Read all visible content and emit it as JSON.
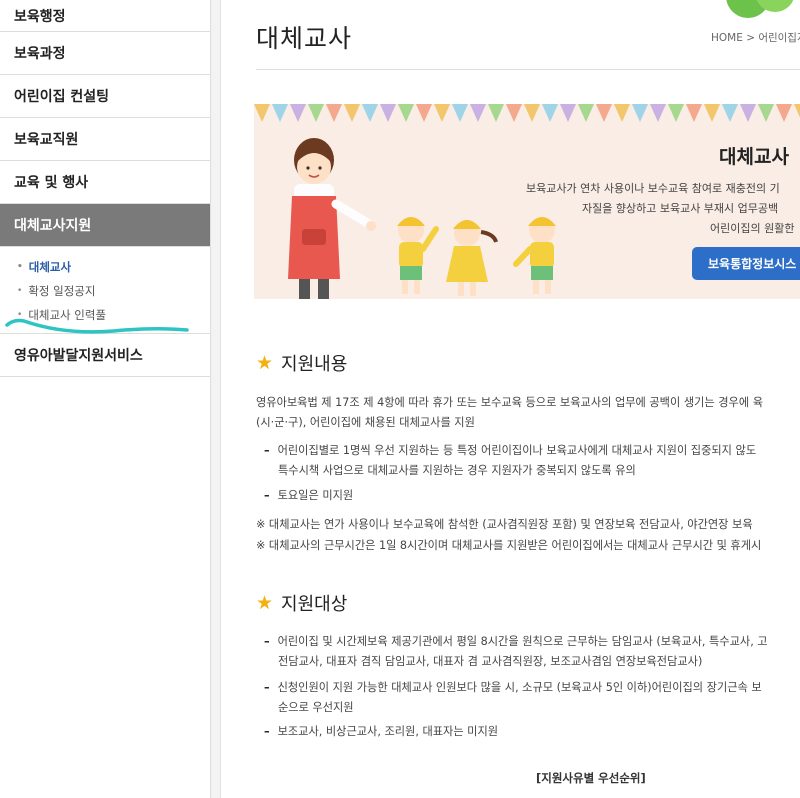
{
  "sidebar": {
    "items": [
      {
        "label": "보육행정"
      },
      {
        "label": "보육과정"
      },
      {
        "label": "어린이집 컨설팅"
      },
      {
        "label": "보육교직원"
      },
      {
        "label": "교육 및 행사"
      },
      {
        "label": "대체교사지원"
      }
    ],
    "subitems": [
      {
        "label": "대체교사"
      },
      {
        "label": "확정 일정공지"
      },
      {
        "label": "대체교사 인력풀"
      }
    ],
    "after": {
      "label": "영유아발달지원서비스"
    }
  },
  "header": {
    "title": "대체교사",
    "breadcrumb": "HOME > 어린이집지"
  },
  "banner": {
    "title": "대체교사",
    "lines": [
      "보육교사가 연차 사용이나 보수교육 참여로 재충전의 기",
      "자질을 향상하고 보육교사 부재시 업무공백",
      "어린이집의 원활한"
    ],
    "button": "보육통합정보시스"
  },
  "section1": {
    "heading": "지원내용",
    "intro": [
      "영유아보육법 제 17조 제 4항에 따라 휴가 또는 보수교육 등으로 보육교사의 업무에 공백이 생기는 경우에 육",
      "(시·군·구), 어린이집에 채용된 대체교사를 지원"
    ],
    "bullets": [
      {
        "lines": [
          "어린이집별로 1명씩 우선 지원하는 등 특정 어린이집이나 보육교사에게 대체교사 지원이 집중되지 않도",
          "특수시책 사업으로 대체교사를 지원하는 경우 지원자가 중복되지 않도록 유의"
        ]
      },
      {
        "lines": [
          "토요일은 미지원"
        ]
      }
    ],
    "notes": [
      "※ 대체교사는 연가 사용이나 보수교육에 참석한 (교사겸직원장 포함) 및 연장보육 전담교사, 야간연장 보육",
      "※ 대체교사의 근무시간은 1일 8시간이며 대체교사를 지원받은 어린이집에서는 대체교사 근무시간 및 휴게시"
    ]
  },
  "section2": {
    "heading": "지원대상",
    "bullets": [
      {
        "lines": [
          "어린이집 및 시간제보육 제공기관에서 평일 8시간을 원칙으로 근무하는 담임교사 (보육교사, 특수교사, 고",
          "전담교사, 대표자 겸직 담임교사, 대표자 겸 교사겸직원장, 보조교사겸임 연장보육전담교사)"
        ]
      },
      {
        "lines": [
          "신청인원이 지원 가능한 대체교사 인원보다 많을 시, 소규모 (보육교사 5인 이하)어린이집의 장기근속 보",
          "순으로 우선지원"
        ]
      },
      {
        "lines": [
          "보조교사, 비상근교사, 조리원, 대표자는 미지원"
        ]
      }
    ],
    "table_caption": "[지원사유별 우선순위]"
  },
  "colors": {
    "accent_blue": "#2d6fc8",
    "active_menu_bg": "#7a7a7a",
    "star": "#f2b011",
    "annotation": "#2ec4c4"
  }
}
